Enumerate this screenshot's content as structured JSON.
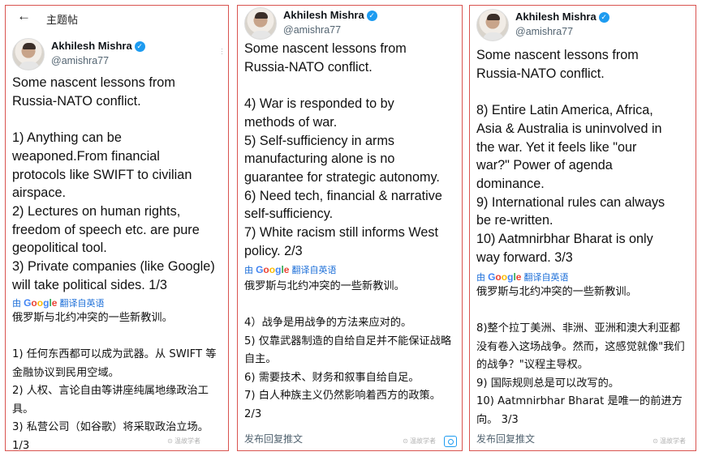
{
  "panel1": {
    "header_title": "主题帖",
    "author_name": "Akhilesh Mishra",
    "handle": "@amishra77",
    "tweet": "Some nascent lessons from\nRussia-NATO conflict.\n\n1) Anything can be\nweaponed.From financial\nprotocols like SWIFT to civilian\nairspace.\n2) Lectures on human rights,\nfreedom of speech etc. are pure\ngeopolitical tool.\n3) Private companies (like Google)\nwill take political sides. 1/3",
    "translate_by": "由",
    "translate_label": "翻译自英语",
    "translation": "俄罗斯与北约冲突的一些新教训。\n\n 1) 任何东西都可以成为武器。从 SWIFT 等\n金融协议到民用空域。\n 2) 人权、言论自由等讲座纯属地缘政治工\n具。\n 3) 私营公司（如谷歌）将采取政治立场。\n1/3",
    "watermark": "⊙ 温故学者"
  },
  "panel2": {
    "author_name": "Akhilesh Mishra",
    "handle": "@amishra77",
    "tweet": "Some nascent lessons from\nRussia-NATO conflict.\n\n4) War is responded to by\nmethods of war.\n5) Self-sufficiency in arms\nmanufacturing alone is no\nguarantee for strategic autonomy.\n6) Need tech, financial & narrative\nself-sufficiency.\n7) White racism still informs West\npolicy. 2/3",
    "translate_by": "由",
    "translate_label": "翻译自英语",
    "translation": "俄罗斯与北约冲突的一些新教训。\n\n 4）战争是用战争的方法来应对的。\n 5) 仅靠武器制造的自给自足并不能保证战略\n自主。\n 6) 需要技术、财务和叙事自给自足。\n 7) 白人种族主义仍然影响着西方的政策。\n2/3",
    "reply_label": "发布回复推文",
    "watermark": "⊙ 温故学者"
  },
  "panel3": {
    "author_name": "Akhilesh Mishra",
    "handle": "@amishra77",
    "tweet": "Some nascent lessons from\nRussia-NATO conflict.\n\n8) Entire Latin America, Africa,\nAsia & Australia is uninvolved in\nthe war. Yet it feels like \"our\nwar?\" Power of agenda\ndominance.\n9) International rules can always\nbe re-written.\n10) Aatmnirbhar Bharat is only\nway forward. 3/3",
    "translate_by": "由",
    "translate_label": "翻译自英语",
    "translation": "俄罗斯与北约冲突的一些新教训。\n\n 8)整个拉丁美洲、非洲、亚洲和澳大利亚都\n没有卷入这场战争。然而，这感觉就像\"我们\n的战争？\"议程主导权。\n 9) 国际规则总是可以改写的。\n 10) Aatmnirbhar Bharat 是唯一的前进方\n向。 3/3",
    "reply_label": "发布回复推文",
    "watermark": "⊙ 温故学者"
  },
  "icons": {
    "back": "←",
    "verified": "✓",
    "more": "···"
  },
  "google_logo": {
    "g1": "G",
    "g2": "o",
    "g3": "o",
    "g4": "g",
    "g5": "l",
    "g6": "e"
  },
  "colors": {
    "accent": "#1d9bf0",
    "frame": "#d9534f",
    "translate_link": "#1d6fd8"
  }
}
